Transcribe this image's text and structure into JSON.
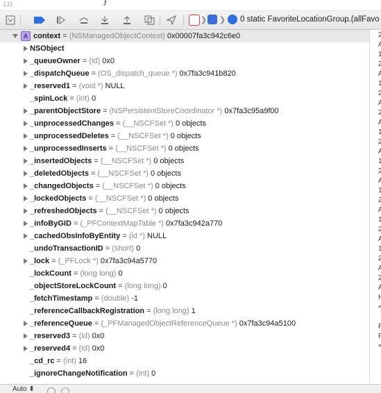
{
  "editor": {
    "line_number": "131",
    "code": "}"
  },
  "toolbar": {
    "icons": [
      "hide-debug-area-icon",
      "breakpoints-toggle-icon",
      "continue-icon",
      "step-over-icon",
      "step-into-icon",
      "step-out-icon",
      "view-hierarchy-icon",
      "memory-graph-icon",
      "location-icon"
    ],
    "breadcrumb_text": "0 static FavoriteLocationGroup.(allFavo"
  },
  "variables": [
    {
      "expand": "down",
      "badge": "A",
      "name": "context",
      "type": "(NSManagedObjectContext)",
      "value": "0x00007fa3c942c6e0"
    },
    {
      "expand": "right",
      "name": "NSObject",
      "type": "",
      "value": ""
    },
    {
      "expand": "right",
      "name": "_queueOwner",
      "type": "(id)",
      "value": "0x0"
    },
    {
      "expand": "right",
      "name": "_dispatchQueue",
      "type": "(OS_dispatch_queue *)",
      "value": "0x7fa3c941b820"
    },
    {
      "expand": "right",
      "name": "_reserved1",
      "type": "(void *)",
      "value": "NULL"
    },
    {
      "expand": "none",
      "name": "_spinLock",
      "type": "(int)",
      "value": "0"
    },
    {
      "expand": "right",
      "name": "_parentObjectStore",
      "type": "(NSPersistentStoreCoordinator *)",
      "value": "0x7fa3c95a9f00"
    },
    {
      "expand": "right",
      "name": "_unprocessedChanges",
      "type": "(__NSCFSet *)",
      "value": "0 objects"
    },
    {
      "expand": "right",
      "name": "_unprocessedDeletes",
      "type": "(__NSCFSet *)",
      "value": "0 objects"
    },
    {
      "expand": "right",
      "name": "_unprocessedInserts",
      "type": "(__NSCFSet *)",
      "value": "0 objects"
    },
    {
      "expand": "right",
      "name": "_insertedObjects",
      "type": "(__NSCFSet *)",
      "value": "0 objects"
    },
    {
      "expand": "right",
      "name": "_deletedObjects",
      "type": "(__NSCFSet *)",
      "value": "0 objects"
    },
    {
      "expand": "right",
      "name": "_changedObjects",
      "type": "(__NSCFSet *)",
      "value": "0 objects"
    },
    {
      "expand": "right",
      "name": "_lockedObjects",
      "type": "(__NSCFSet *)",
      "value": "0 objects"
    },
    {
      "expand": "right",
      "name": "_refreshedObjects",
      "type": "(__NSCFSet *)",
      "value": "0 objects"
    },
    {
      "expand": "right",
      "name": "_infoByGID",
      "type": "(_PFContextMapTable *)",
      "value": "0x7fa3c942a770"
    },
    {
      "expand": "right",
      "name": "_cachedObsInfoByEntity",
      "type": "(id *)",
      "value": "NULL"
    },
    {
      "expand": "none",
      "name": "_undoTransactionID",
      "type": "(short)",
      "value": "0"
    },
    {
      "expand": "right",
      "name": "_lock",
      "type": "(_PFLock *)",
      "value": "0x7fa3c94a5770"
    },
    {
      "expand": "none",
      "name": "_lockCount",
      "type": "(long long)",
      "value": "0"
    },
    {
      "expand": "none",
      "name": "_objectStoreLockCount",
      "type": "(long long)",
      "value": "0"
    },
    {
      "expand": "none",
      "name": "_fetchTimestamp",
      "type": "(double)",
      "value": "-1"
    },
    {
      "expand": "none",
      "name": "_referenceCallbackRegistration",
      "type": "(long long)",
      "value": "1"
    },
    {
      "expand": "right",
      "name": "_referenceQueue",
      "type": "(_PFManagedObjectReferenceQueue *)",
      "value": "0x7fa3c94a5100"
    },
    {
      "expand": "right",
      "name": "_reserved3",
      "type": "(id)",
      "value": "0x0"
    },
    {
      "expand": "right",
      "name": "_reserved4",
      "type": "(id)",
      "value": "0x0"
    },
    {
      "expand": "none",
      "name": "_cd_rc",
      "type": "(int)",
      "value": "16"
    },
    {
      "expand": "none",
      "name": "_ignoreChangeNotification",
      "type": "(int)",
      "value": "0"
    }
  ],
  "console_edge": [
    "2",
    "A",
    "1",
    "2",
    "A",
    "1",
    "2",
    "A",
    "2",
    "A",
    "1",
    "2",
    "A",
    "1",
    "2",
    "A",
    "1",
    "2",
    "A",
    "1",
    "2",
    "A",
    "1",
    "2",
    "A",
    "2",
    "A",
    "H",
    "<",
    "",
    "F",
    "F",
    "<",
    "",
    ""
  ],
  "footer": {
    "auto_label": "Auto ⬍"
  }
}
